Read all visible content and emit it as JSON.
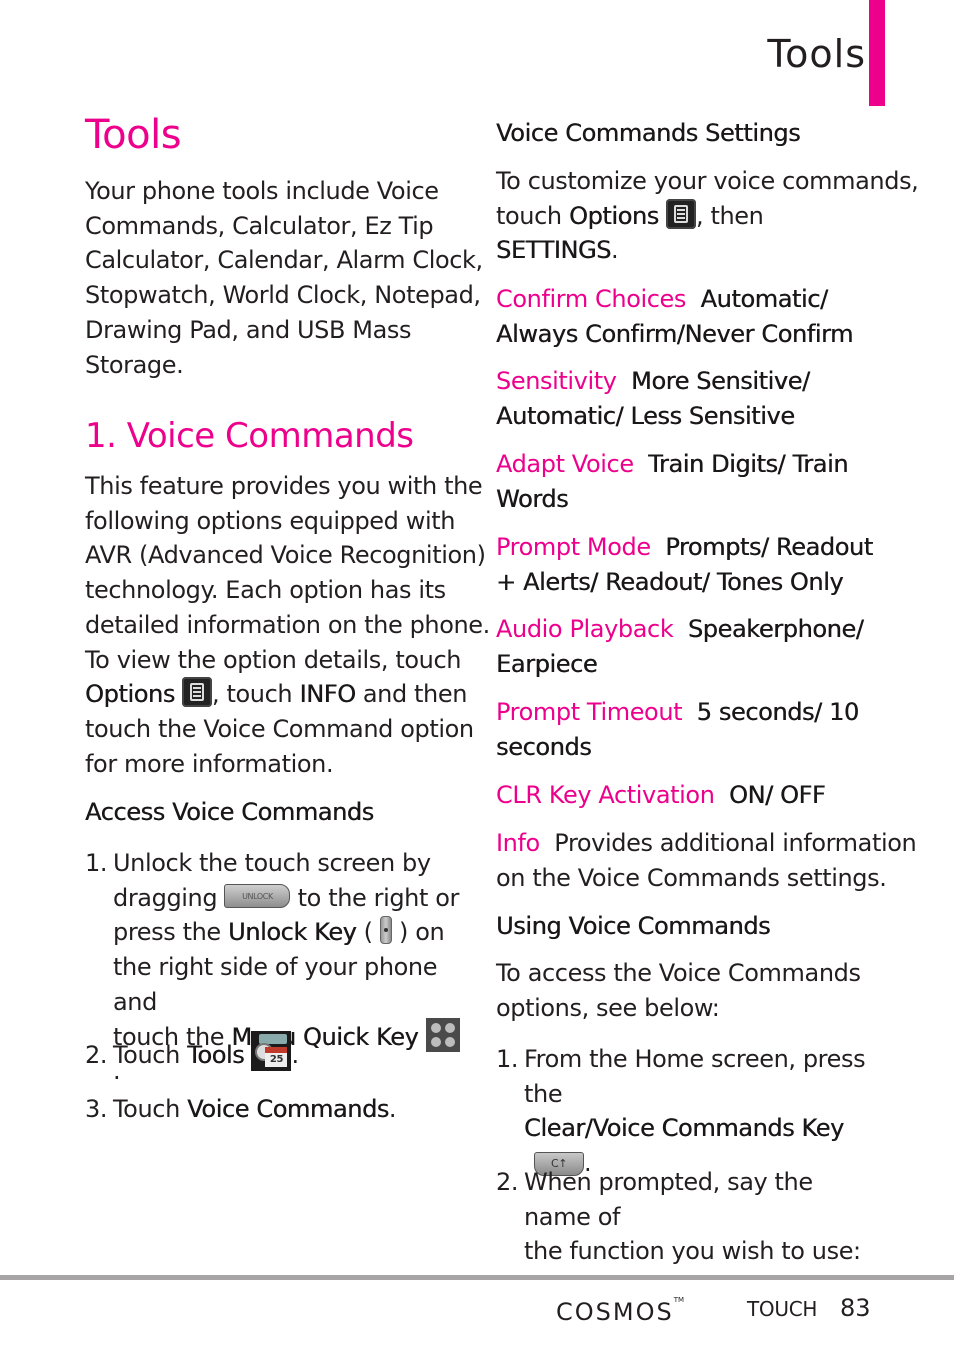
{
  "header": {
    "section_tab_title": "Tools",
    "accent_color": "#ec008c"
  },
  "left": {
    "title": "Tools",
    "intro_lines": [
      "Your phone tools include Voice",
      "Commands, Calculator, Ez Tip",
      "Calculator, Calendar, Alarm Clock,",
      "Stopwatch, World Clock, Notepad,",
      "Drawing Pad, and USB Mass",
      "Storage."
    ],
    "section_heading": "1. Voice Commands",
    "feature_lines": [
      "This feature provides you with the",
      "following options equipped with",
      "AVR (Advanced Voice Recognition)",
      "technology. Each option has its",
      "detailed information on the phone.",
      "To view the option details, touch"
    ],
    "options_line": {
      "options": "Options",
      "mid": ", touch ",
      "info": "INFO",
      "end": " and then"
    },
    "feature_tail_lines": [
      "touch the Voice Command option",
      "for more information."
    ],
    "access_heading": "Access Voice Commands",
    "step1": {
      "num": "1.",
      "line1": "Unlock the touch screen by",
      "line2_pre": "dragging",
      "unlock_icon_text": "UNLOCK",
      "line2_post": " to the right or",
      "line3_pre": "press the ",
      "unlock_key": "Unlock Key",
      "line3_paren_open": " ( ",
      "line3_paren_close": " ) on",
      "line4": "the right side of your phone and",
      "line5_pre": "touch the ",
      "menu_quick_key": "Menu Quick Key",
      "line5_post": " ."
    },
    "step2": {
      "num": "2.",
      "pre": "Touch ",
      "bold": "Tools",
      "post": ".",
      "icon_day": "25"
    },
    "step3": {
      "num": "3.",
      "pre": "Touch ",
      "bold": "Voice Commands",
      "post": "."
    }
  },
  "right": {
    "settings_heading": "Voice Commands Settings",
    "settings_line1": "To customize your voice commands,",
    "settings_line2": {
      "pre": "touch ",
      "options": "Options",
      "post": ", then"
    },
    "settings_line3": {
      "bold": "SETTINGS",
      "post": "."
    },
    "settings": [
      {
        "label": "Confirm Choices",
        "value_line1": "Automatic/",
        "value_line2": "Always Confirm/Never Confirm"
      },
      {
        "label": "Sensitivity",
        "value_line1": "More Sensitive/",
        "value_line2": "Automatic/ Less Sensitive"
      },
      {
        "label": "Adapt Voice",
        "value_line1": "Train Digits/ Train",
        "value_line2": "Words"
      },
      {
        "label": "Prompt Mode",
        "value_line1": "Prompts/ Readout",
        "value_line2": "+ Alerts/ Readout/ Tones Only"
      },
      {
        "label": "Audio Playback",
        "value_line1": "Speakerphone/",
        "value_line2": "Earpiece"
      },
      {
        "label": "Prompt Timeout",
        "value_line1": "5 seconds/ 10",
        "value_line2": "seconds"
      },
      {
        "label": "CLR Key Activation",
        "value_line1": "ON/ OFF"
      }
    ],
    "info": {
      "label": "Info",
      "line1": "Provides additional information",
      "line2": "on the Voice Commands settings."
    },
    "using_heading": "Using Voice Commands",
    "using_lines": [
      "To access the Voice Commands",
      "options, see below:"
    ],
    "step1": {
      "num": "1.",
      "line1": "From the Home screen, press the",
      "bold": "Clear/Voice Commands Key",
      "icon_text": "C↑",
      "post": "."
    },
    "step2": {
      "num": "2.",
      "line1": "When prompted, say the name of",
      "line2": "the function you wish to use:"
    }
  },
  "footer": {
    "brand": "COSMOS",
    "tm": "TM",
    "model": "TOUCH",
    "page_number": "83"
  }
}
